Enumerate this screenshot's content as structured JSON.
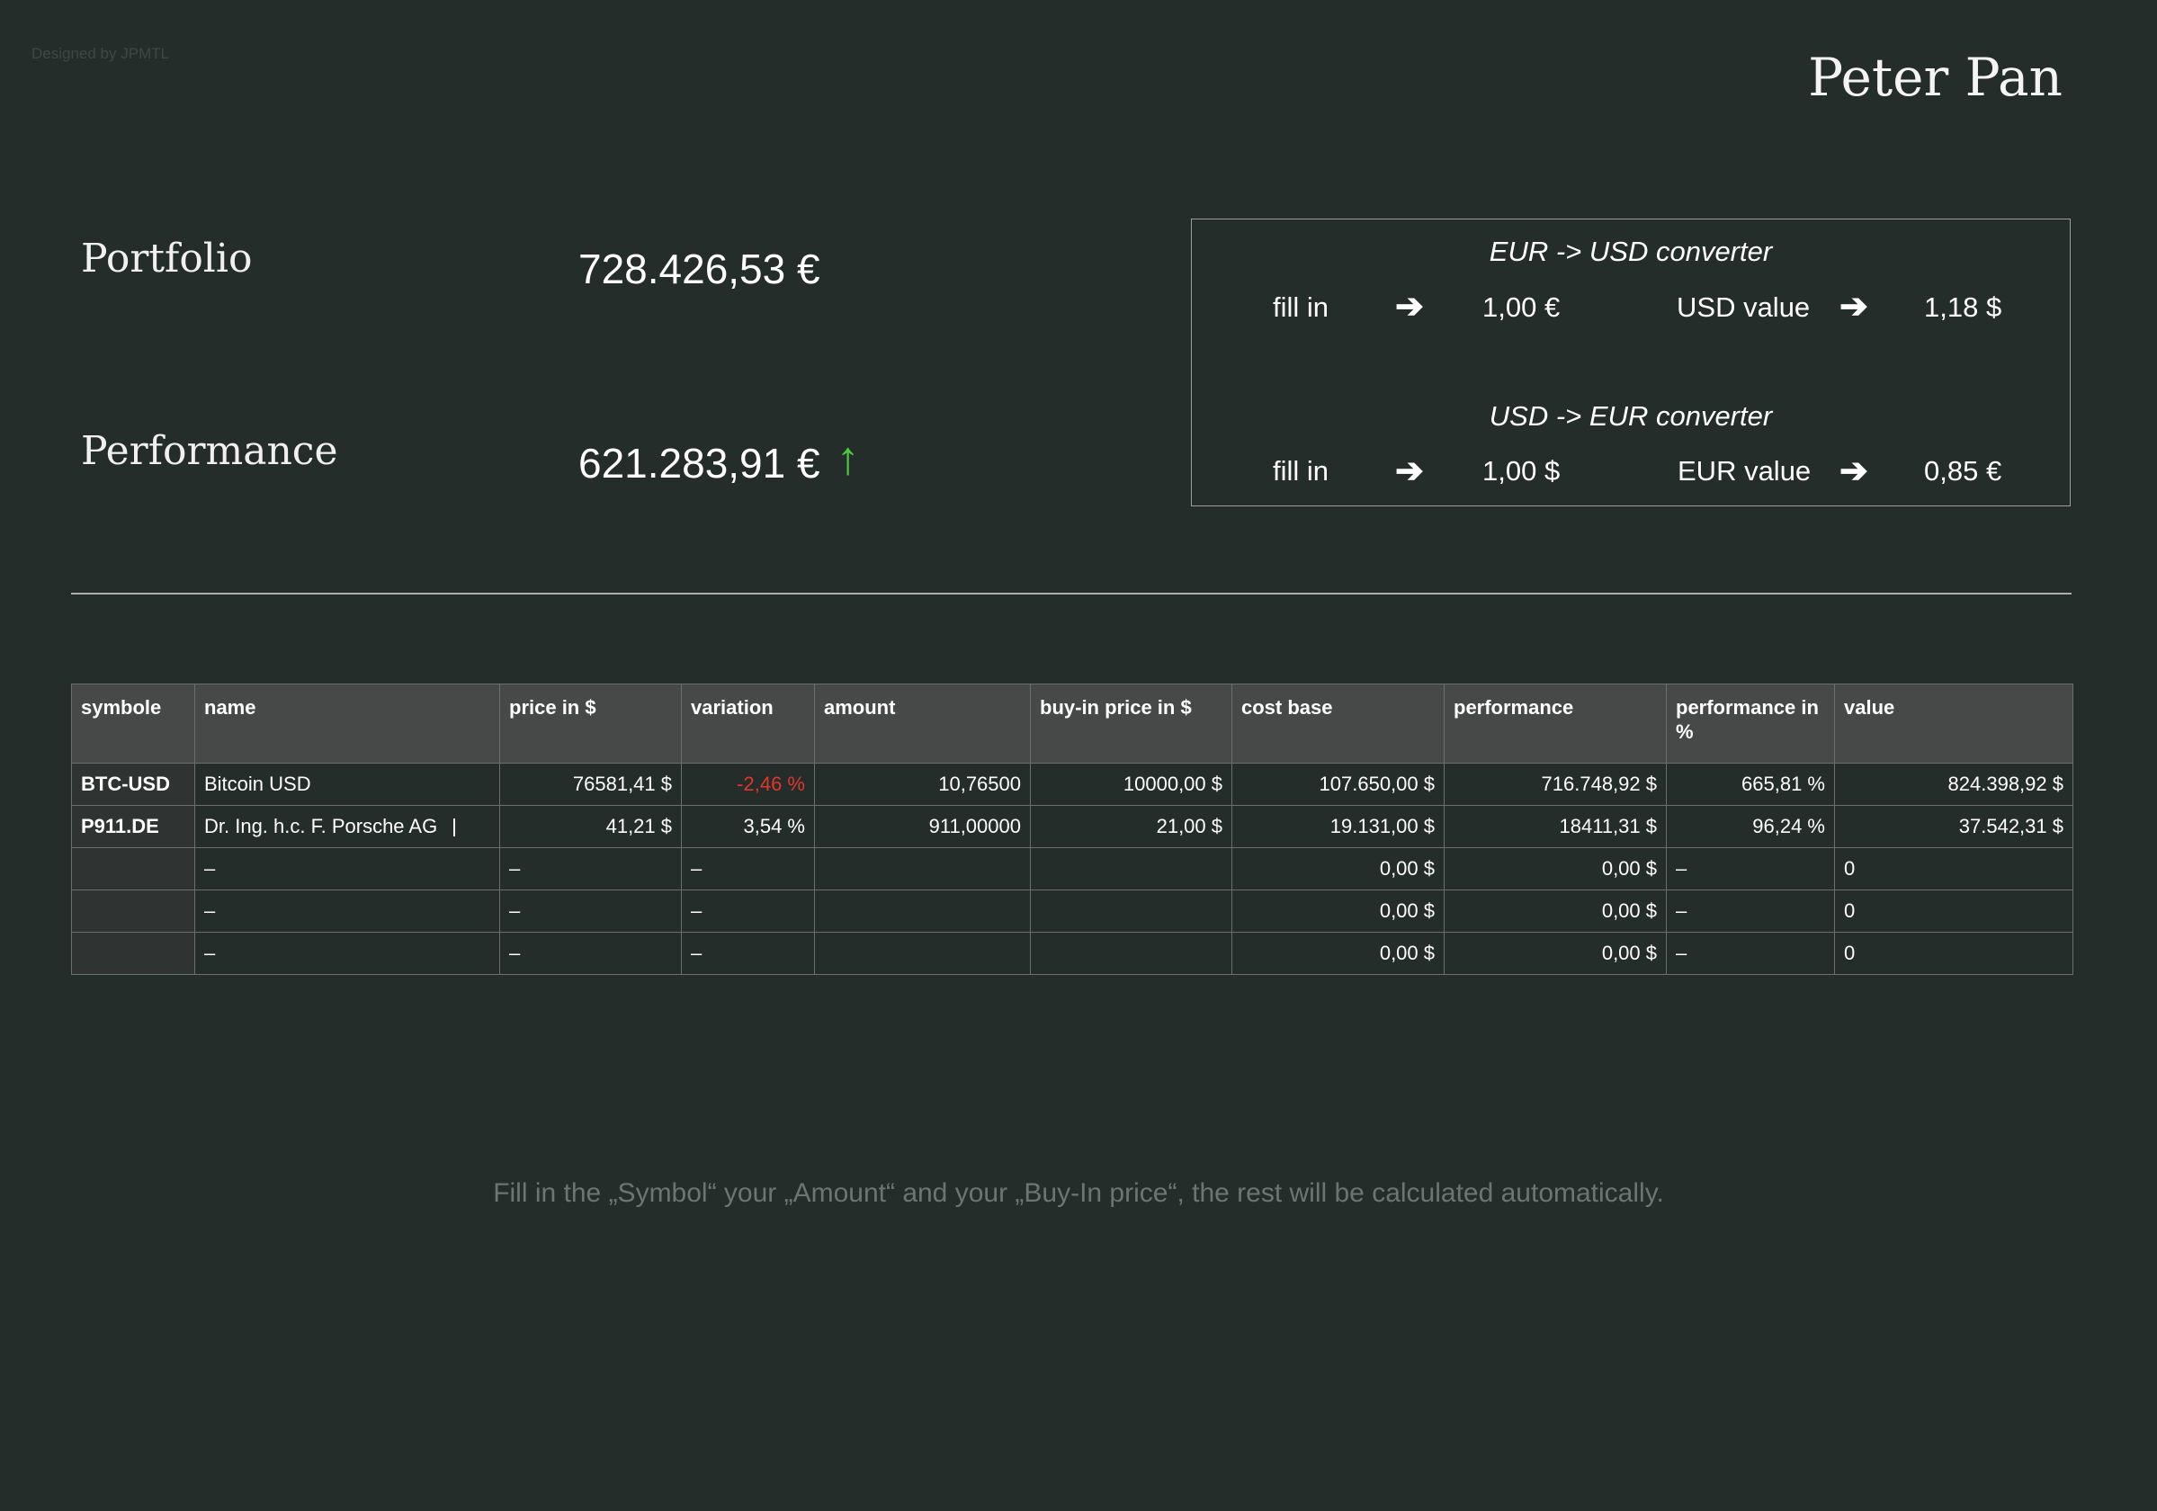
{
  "header": {
    "designer": "Designed by JPMTL",
    "owner": "Peter Pan"
  },
  "summary": {
    "portfolio_label": "Portfolio",
    "portfolio_value": "728.426,53 €",
    "performance_label": "Performance",
    "performance_value": "621.283,91 €",
    "performance_trend_icon": "arrow-up-icon",
    "performance_trend_glyph": "↑",
    "trend_color": "#4cc93c"
  },
  "converter": {
    "eur_usd": {
      "title": "EUR -> USD converter",
      "fill_label": "fill in",
      "input_value": "1,00 €",
      "result_label": "USD value",
      "result_value": "1,18 $"
    },
    "usd_eur": {
      "title": "USD -> EUR converter",
      "fill_label": "fill in",
      "input_value": "1,00 $",
      "result_label": "EUR value",
      "result_value": "0,85 €"
    },
    "arrow_glyph": "➔"
  },
  "table": {
    "headers": [
      "symbole",
      "name",
      "price in $",
      "variation",
      "amount",
      "buy-in price in $",
      "cost base",
      "performance",
      "performance in %",
      "value"
    ],
    "rows": [
      [
        "BTC-USD",
        "Bitcoin USD",
        "76581,41 $",
        "-2,46 %",
        "10,76500",
        "10000,00 $",
        "107.650,00 $",
        "716.748,92 $",
        "665,81 %",
        "824.398,92 $"
      ],
      [
        "P911.DE",
        "Dr. Ing. h.c. F. Porsche AG",
        "41,21 $",
        "3,54 %",
        "911,00000",
        "21,00 $",
        "19.131,00 $",
        "18411,31 $",
        "96,24 %",
        "37.542,31 $"
      ],
      [
        "",
        "–",
        "–",
        "–",
        "",
        "",
        "0,00 $",
        "0,00 $",
        "–",
        "0"
      ],
      [
        "",
        "–",
        "–",
        "–",
        "",
        "",
        "0,00 $",
        "0,00 $",
        "–",
        "0"
      ],
      [
        "",
        "–",
        "–",
        "–",
        "",
        "",
        "0,00 $",
        "0,00 $",
        "–",
        "0"
      ]
    ],
    "negative_color": "#e0362c"
  },
  "hint": "Fill in the „Symbol“ your „Amount“ and your „Buy-In price“, the rest will be calculated automatically."
}
